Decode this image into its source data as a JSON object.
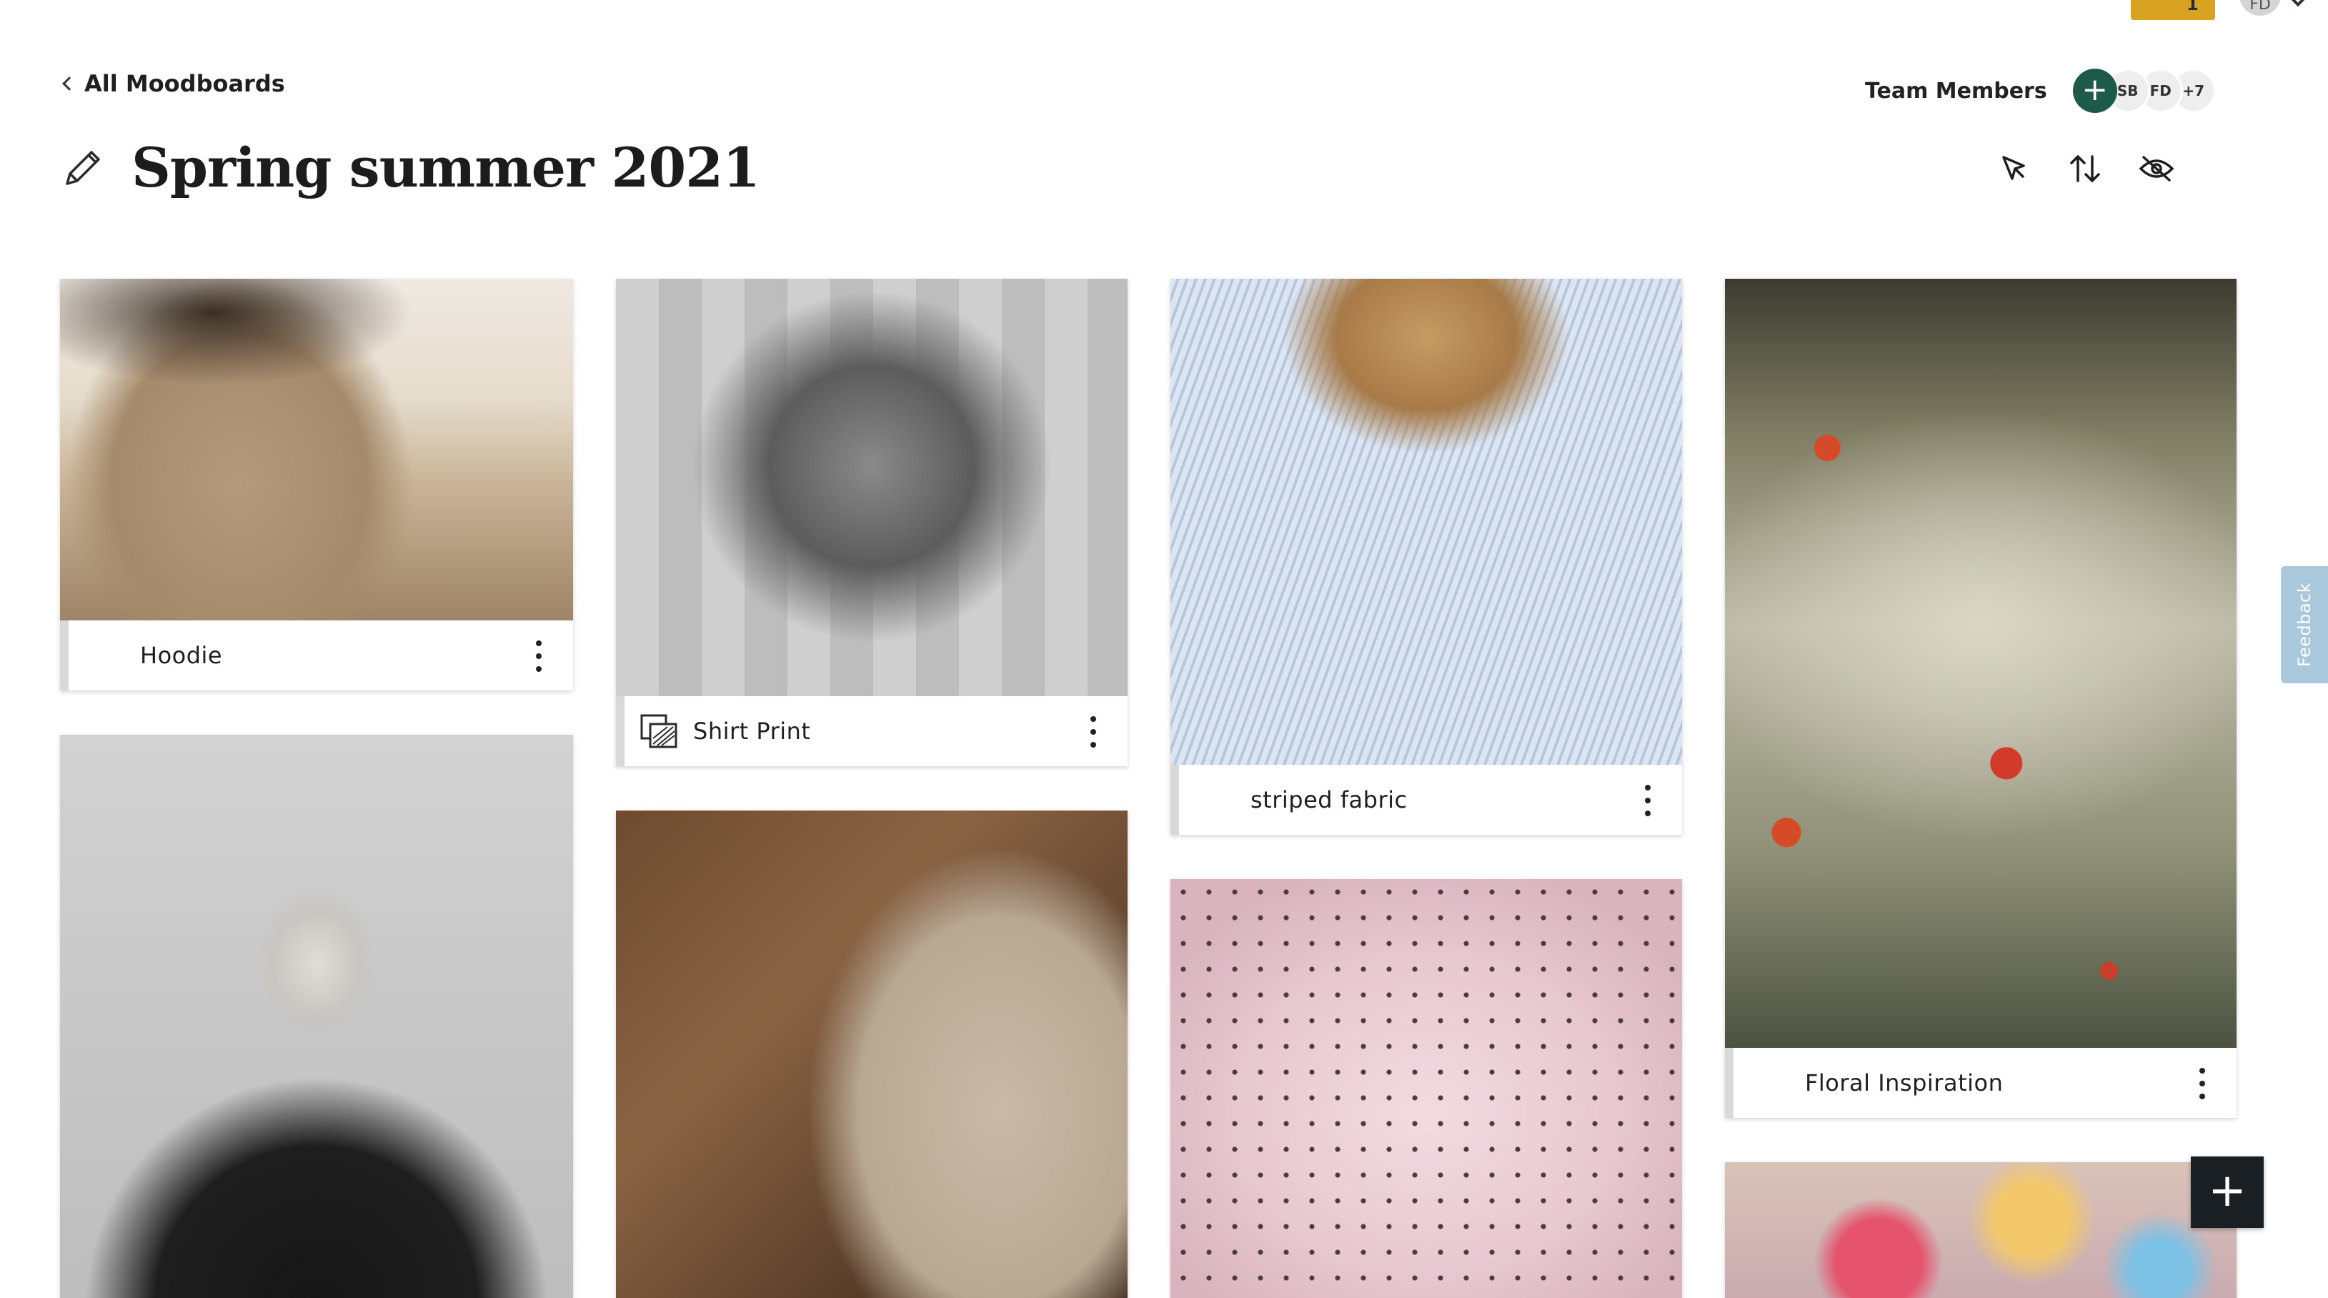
{
  "topbar": {
    "notification_count": "1",
    "user_initials": "FD"
  },
  "header": {
    "back_label": "All Moodboards",
    "title": "Spring summer 2021",
    "team_label": "Team Members",
    "add_member_symbol": "+",
    "members": [
      "SB",
      "FD",
      "+7"
    ]
  },
  "toolbar": {
    "icons": [
      "cursor-select-icon",
      "sort-arrows-icon",
      "hide-eye-icon"
    ]
  },
  "cards": [
    {
      "label": "Hoodie",
      "image": "hoodie-desert-photo"
    },
    {
      "label": "Shirt Print",
      "image": "palm-print-shirt-photo",
      "icon": "print-pattern-icon"
    },
    {
      "label": "striped fabric",
      "image": "striped-shirt-photo"
    },
    {
      "label": "Floral Inspiration",
      "image": "wildflower-field-photo"
    },
    {
      "label": "",
      "image": "portrait-black-hoodie-photo"
    },
    {
      "label": "",
      "image": "beige-tshirt-photo"
    },
    {
      "label": "",
      "image": "pink-polka-dress-photo"
    },
    {
      "label": "",
      "image": "tie-dye-garment-photo"
    }
  ],
  "fab": {
    "symbol": "+"
  },
  "feedback_label": "Feedback",
  "colors": {
    "accent_green": "#1e5a4a",
    "fab_dark": "#1a1f24",
    "badge_gold": "#d8a321",
    "feedback_blue": "#a9c8dc"
  }
}
